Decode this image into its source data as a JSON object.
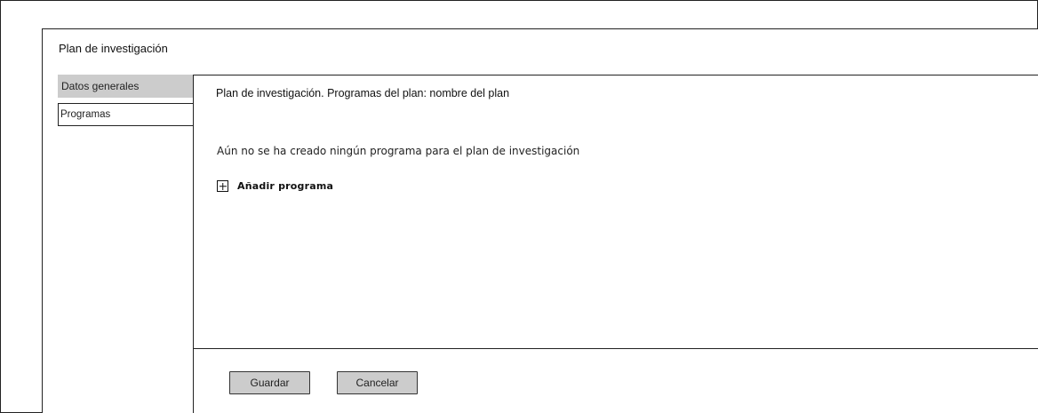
{
  "page": {
    "title": "Plan de investigación"
  },
  "tabs": [
    {
      "label": "Datos generales",
      "active": true
    },
    {
      "label": "Programas",
      "active": false
    }
  ],
  "panel": {
    "heading": "Plan de investigación. Programas del plan: nombre del plan",
    "empty_message": "Aún no se ha creado ningún programa para el plan de investigación",
    "add_action": {
      "icon": "plus-square-icon",
      "label": "Añadir programa"
    }
  },
  "footer": {
    "save_label": "Guardar",
    "cancel_label": "Cancelar"
  },
  "colors": {
    "border": "#222222",
    "tab_active_bg": "#cccccc",
    "button_bg": "#cccccc"
  }
}
